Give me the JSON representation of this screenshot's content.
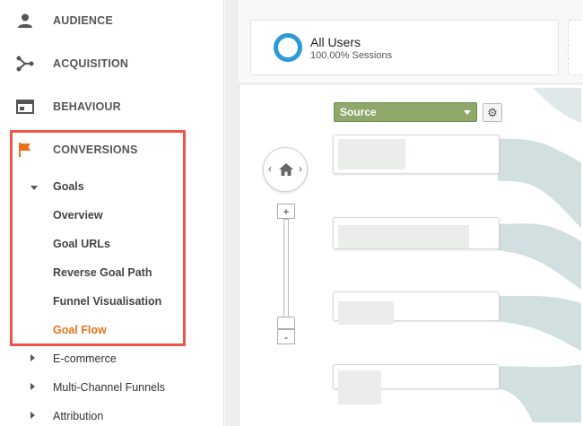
{
  "sidebar": {
    "audience": "AUDIENCE",
    "acquisition": "ACQUISITION",
    "behaviour": "BEHAVIOUR",
    "conversions": "CONVERSIONS",
    "goals": "Goals",
    "goal_items": [
      "Overview",
      "Goal URLs",
      "Reverse Goal Path",
      "Funnel Visualisation",
      "Goal Flow"
    ],
    "active_item": "Goal Flow",
    "collapsed_sections": [
      "E-commerce",
      "Multi-Channel Funnels",
      "Attribution"
    ]
  },
  "segment": {
    "title": "All Users",
    "subtitle": "100.00% Sessions",
    "ring_color": "#2d9ad6"
  },
  "flow": {
    "dimension_label": "Source",
    "settings_icon": "gear-icon",
    "zoom_plus": "+",
    "zoom_minus": "-",
    "pan_left": "‹",
    "pan_right": "›"
  },
  "colors": {
    "accent_orange": "#e8711c",
    "highlight_red": "#f0554a",
    "dimension_green": "#8ea86b",
    "flow_band": "#c9d9dc"
  }
}
